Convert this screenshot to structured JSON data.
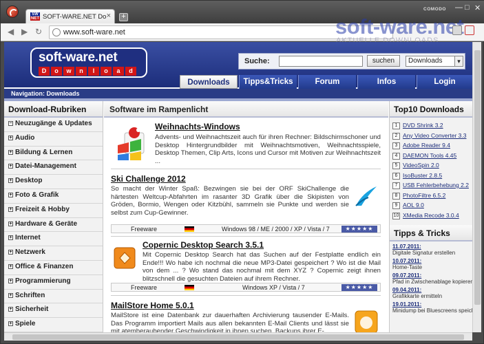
{
  "browser": {
    "tab_title": "SOFT-WARE.NET Download",
    "tab_close": "×",
    "new_tab": "+",
    "brand": "COMODO",
    "window_controls": [
      "—",
      "□",
      "✕"
    ],
    "url": "www.soft-ware.net",
    "nav": {
      "back": "◀",
      "forward": "▶",
      "reload": "↻"
    },
    "favicon_top": "SW",
    "favicon_bottom": "NET"
  },
  "watermark": {
    "title": "soft-ware.net",
    "subtitle": "AKTUELLE DOWNLOADS"
  },
  "header": {
    "logo_top": "soft-ware.net",
    "logo_bottom": [
      "D",
      "o",
      "w",
      "n",
      "l",
      "o",
      "a",
      "d"
    ],
    "search_label": "Suche:",
    "search_button": "suchen",
    "search_scope": "Downloads",
    "menu": [
      "Downloads",
      "Tipps&Tricks",
      "Forum",
      "Infos",
      "Login"
    ],
    "navigation": "Navigation:  Downloads"
  },
  "left": {
    "heading": "Download-Rubriken",
    "categories": [
      "Neuzugänge & Updates",
      "Audio",
      "Bildung & Lernen",
      "Datei-Management",
      "Desktop",
      "Foto & Grafik",
      "Freizeit & Hobby",
      "Hardware & Geräte",
      "Internet",
      "Netzwerk",
      "Office & Finanzen",
      "Programmierung",
      "Schriften",
      "Sicherheit",
      "Spiele"
    ]
  },
  "main": {
    "heading": "Software im Rampenlicht",
    "items": [
      {
        "title": "Weihnachts-Windows",
        "text": "Advents- und Weihnachtszeit auch für ihren Rechner: Bildschirmschoner und Desktop Hintergrundbilder mit Weihnachtsmotiven, Weihnachtsspiele, Desktop Themen, Clip Arts, Icons und Cursor mit Motiven zur Weihnachtszeit ..."
      },
      {
        "title": "Ski Challenge 2012",
        "text": "So macht der Winter Spaß: Bezwingen sie bei der ORF SkiChallenge die härtesten Weltcup-Abfahrten im rasanter 3D Grafik über die Skipisten von Gröden, Bormio, Wengen oder Kitzbühl, sammeln sie Punkte und werden sie selbst zum Cup-Gewinner.",
        "license": "Freeware",
        "os": "Windows 98 / ME / 2000 / XP / Vista / 7",
        "stars": "★★★★★"
      },
      {
        "title": "Copernic Desktop Search 3.5.1",
        "text": "Mit Copernic Desktop Search hat das Suchen auf der Festplatte endlich ein Ende!!! Wo habe ich nochmal die neue MP3-Datei gespeichert ? Wo ist die Mail von dem ... ? Wo stand das nochmal mit dem XYZ ? Copernic zeigt ihnen blitzschnell die gesuchten Dateien auf ihrem Rechner.",
        "license": "Freeware",
        "os": "Windows XP / Vista / 7",
        "stars": "★★★★★"
      },
      {
        "title": "MailStore Home 5.0.1",
        "text": "MailStore ist eine Datenbank zur dauerhaften Archivierung tausender E-Mails. Das Programm importiert Mails aus allen bekannten E-Mail Clients und lässt sie mit atemberaubender Geschwindigkeit in ihnen suchen. Backups ihrer E-"
      }
    ]
  },
  "right": {
    "top10_heading": "Top10 Downloads",
    "top10": [
      {
        "n": "1",
        "name": "DVD Shrink 3.2"
      },
      {
        "n": "2",
        "name": "Any Video Converter 3.3"
      },
      {
        "n": "3",
        "name": "Adobe Reader 9.4"
      },
      {
        "n": "4",
        "name": "DAEMON Tools 4.45"
      },
      {
        "n": "5",
        "name": "VideoSpin 2.0"
      },
      {
        "n": "6",
        "name": "IsoBuster 2.8.5"
      },
      {
        "n": "7",
        "name": "USB Fehlerbehebung 2.2"
      },
      {
        "n": "8",
        "name": "PhotoFiltre 6.5.2"
      },
      {
        "n": "9",
        "name": "AOL 9.0"
      },
      {
        "n": "10",
        "name": "XMedia Recode 3.0.4"
      }
    ],
    "tipps_heading": "Tipps & Tricks",
    "tipps": [
      {
        "date": "11.07.2011:",
        "text": "Digitale Signatur erstellen"
      },
      {
        "date": "10.07.2011:",
        "text": "Home-Taste"
      },
      {
        "date": "09.07.2011:",
        "text": "Pfad in Zwischenablage kopieren"
      },
      {
        "date": "09.04.2011:",
        "text": "Grafikkarte ermitteln"
      },
      {
        "date": "19.01.2011:",
        "text": "Minidump bei Bluescreens speichern"
      }
    ]
  }
}
